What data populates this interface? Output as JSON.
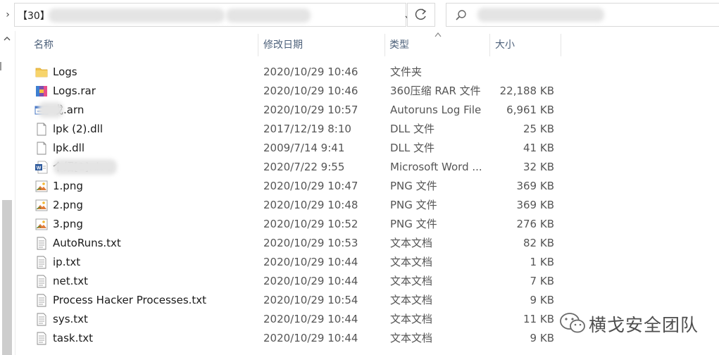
{
  "address_bar": {
    "path_prefix": "【30】",
    "dropdown_icon": "chevron-down-icon"
  },
  "toolbar": {
    "refresh_icon": "refresh-icon",
    "search_icon": "search-icon"
  },
  "columns": {
    "name": "名称",
    "date": "修改日期",
    "type": "类型",
    "size": "大小"
  },
  "files": [
    {
      "icon": "folder-icon",
      "name": "Logs",
      "date": "2020/10/29 10:46",
      "type": "文件夹",
      "size": ""
    },
    {
      "icon": "archive-icon",
      "name": "Logs.rar",
      "date": "2020/10/29 10:46",
      "type": "360压缩 RAR 文件",
      "size": "22,188 KB"
    },
    {
      "icon": "autoruns-icon",
      "name": "戉.arn",
      "date": "2020/10/29 10:57",
      "type": "Autoruns Log File",
      "size": "6,961 KB"
    },
    {
      "icon": "file-icon",
      "name": "lpk (2).dll",
      "date": "2017/12/19 8:10",
      "type": "DLL 文件",
      "size": "25 KB"
    },
    {
      "icon": "file-icon",
      "name": "lpk.dll",
      "date": "2009/7/14 9:41",
      "type": "DLL 文件",
      "size": "41 KB"
    },
    {
      "icon": "word-icon",
      "name": "个绍[1].doc",
      "date": "2020/7/22 9:55",
      "type": "Microsoft Word ...",
      "size": "32 KB"
    },
    {
      "icon": "image-icon",
      "name": "1.png",
      "date": "2020/10/29 10:47",
      "type": "PNG 文件",
      "size": "369 KB"
    },
    {
      "icon": "image-icon",
      "name": "2.png",
      "date": "2020/10/29 10:48",
      "type": "PNG 文件",
      "size": "369 KB"
    },
    {
      "icon": "image-icon",
      "name": "3.png",
      "date": "2020/10/29 10:52",
      "type": "PNG 文件",
      "size": "276 KB"
    },
    {
      "icon": "text-file-icon",
      "name": "AutoRuns.txt",
      "date": "2020/10/29 10:53",
      "type": "文本文档",
      "size": "82 KB"
    },
    {
      "icon": "text-file-icon",
      "name": "ip.txt",
      "date": "2020/10/29 10:44",
      "type": "文本文档",
      "size": "1 KB"
    },
    {
      "icon": "text-file-icon",
      "name": "net.txt",
      "date": "2020/10/29 10:44",
      "type": "文本文档",
      "size": "7 KB"
    },
    {
      "icon": "text-file-icon",
      "name": "Process Hacker Processes.txt",
      "date": "2020/10/29 10:54",
      "type": "文本文档",
      "size": "9 KB"
    },
    {
      "icon": "text-file-icon",
      "name": "sys.txt",
      "date": "2020/10/29 10:44",
      "type": "文本文档",
      "size": "11 KB"
    },
    {
      "icon": "text-file-icon",
      "name": "task.txt",
      "date": "2020/10/29 10:44",
      "type": "文本文档",
      "size": "9 KB"
    }
  ],
  "watermark": {
    "text": "横戈安全团队",
    "icon": "wechat-icon"
  },
  "colors": {
    "header_text": "#4c607a",
    "folder": "#f1c24c",
    "word": "#2b579a",
    "scrollbar": "#cdcdcd"
  }
}
